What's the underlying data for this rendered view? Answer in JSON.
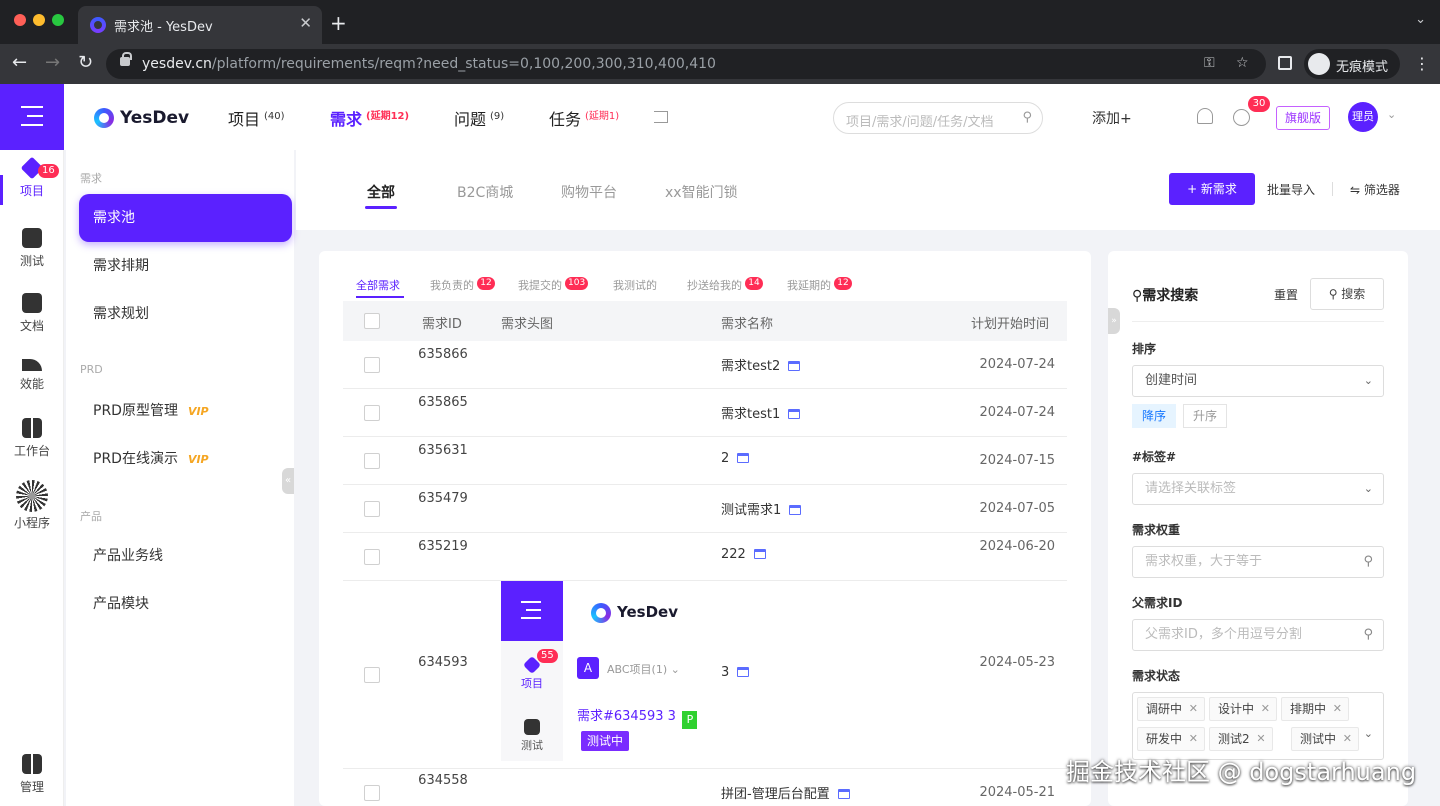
{
  "browser": {
    "tab_title": "需求池 - YesDev",
    "url_domain": "yesdev.cn",
    "url_path": "/platform/requirements/reqm?need_status=0,100,200,300,310,400,410",
    "incognito_label": "无痕模式"
  },
  "header": {
    "logo_text": "YesDev",
    "nav": [
      {
        "label": "项目",
        "badge": "(40)"
      },
      {
        "label": "需求",
        "badge": "(延期12)"
      },
      {
        "label": "问题",
        "badge": "(9)"
      },
      {
        "label": "任务",
        "badge": "(延期1)"
      }
    ],
    "search_placeholder": "项目/需求/问题/任务/文档",
    "add_label": "添加+",
    "notification_count": "30",
    "edition_badge": "旗舰版",
    "avatar_text": "理员"
  },
  "iconbar": {
    "items": [
      {
        "label": "项目",
        "badge": "16",
        "icon": "cube-icon"
      },
      {
        "label": "测试",
        "icon": "test-icon"
      },
      {
        "label": "文档",
        "icon": "doc-icon"
      },
      {
        "label": "效能",
        "icon": "chart-icon"
      },
      {
        "label": "工作台",
        "icon": "workbench-icon"
      },
      {
        "label": "小程序",
        "icon": "qrcode-icon"
      },
      {
        "label": "管理",
        "icon": "manage-icon"
      }
    ]
  },
  "subnav": {
    "groups": {
      "req": "需求",
      "prd": "PRD",
      "product": "产品"
    },
    "items": [
      "需求池",
      "需求排期",
      "需求规划",
      "PRD原型管理",
      "PRD在线演示",
      "产品业务线",
      "产品模块"
    ],
    "vip_label": "VIP"
  },
  "content_tabs": [
    "全部",
    "B2C商城",
    "购物平台",
    "xx智能门锁"
  ],
  "actions": {
    "new": "+ 新需求",
    "import": "批量导入",
    "filter": "筛选器"
  },
  "subtabs": [
    {
      "label": "全部需求"
    },
    {
      "label": "我负责的",
      "count": "12"
    },
    {
      "label": "我提交的",
      "count": "103"
    },
    {
      "label": "我测试的"
    },
    {
      "label": "抄送给我的",
      "count": "14"
    },
    {
      "label": "我延期的",
      "count": "12"
    }
  ],
  "table": {
    "columns": [
      "需求ID",
      "需求头图",
      "需求名称",
      "计划开始时间"
    ],
    "rows": [
      {
        "id": "635866",
        "name": "需求test2",
        "date": "2024-07-24"
      },
      {
        "id": "635865",
        "name": "需求test1",
        "date": "2024-07-24"
      },
      {
        "id": "635631",
        "name": "2",
        "date": "2024-07-15"
      },
      {
        "id": "635479",
        "name": "测试需求1",
        "date": "2024-07-05"
      },
      {
        "id": "635219",
        "name": "222",
        "date": "2024-06-20"
      },
      {
        "id": "634593",
        "name": "3",
        "date": "2024-05-23"
      },
      {
        "id": "634558",
        "name": "拼团-管理后台配置",
        "date": "2024-05-21"
      }
    ],
    "thumbnail": {
      "logo": "YesDev",
      "nav_item_1": "项目",
      "nav_badge": "55",
      "nav_item_2": "测试",
      "project_initial": "A",
      "project_name": "ABC项目(1)",
      "link": "需求#634593 3",
      "p_tag": "P",
      "status": "测试中"
    }
  },
  "filter": {
    "title": "需求搜索",
    "reset": "重置",
    "search": "搜索",
    "sort_label": "排序",
    "sort_value": "创建时间",
    "sort_desc": "降序",
    "sort_asc": "升序",
    "tag_label": "#标签#",
    "tag_placeholder": "请选择关联标签",
    "weight_label": "需求权重",
    "weight_placeholder": "需求权重，大于等于",
    "parent_label": "父需求ID",
    "parent_placeholder": "父需求ID，多个用逗号分割",
    "status_label": "需求状态",
    "status_tags": [
      "调研中",
      "设计中",
      "排期中",
      "研发中",
      "测试2",
      "测试中"
    ]
  },
  "watermark": "掘金技术社区 @ dogstarhuang",
  "colors": {
    "brand": "#5b21ff",
    "badge": "#ff2d55",
    "vip": "#f5a623"
  }
}
